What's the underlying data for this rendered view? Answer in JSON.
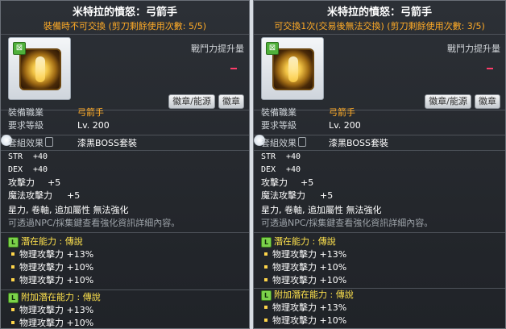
{
  "left": {
    "title": "米特拉的憤怒：弓箭手",
    "subtitle": "裝備時不可交換 (剪刀剩餘使用次數: 5/5)",
    "power_label": "戰鬥力提升量",
    "buttons": [
      "徽章/能源",
      "徽章"
    ],
    "job_label": "裝備職業",
    "job_value": "弓箭手",
    "req_label": "要求等級",
    "req_value": "Lv. 200",
    "set_label": "套組效果",
    "set_value": "漆黑BOSS套裝",
    "stats": [
      {
        "label": "STR",
        "value": "+40"
      },
      {
        "label": "DEX",
        "value": "+40"
      },
      {
        "label": "攻擊力",
        "value": "+5"
      },
      {
        "label": "魔法攻擊力",
        "value": "+5"
      }
    ],
    "notes": "星力, 卷軸, 追加屬性 無法強化",
    "npc_note": "可透過NPC/採集鍵查看強化資訊詳細內容。",
    "potential_title": "潛在能力 : 傳說",
    "potential_lines": [
      "物理攻擊力 +13%",
      "物理攻擊力 +10%",
      "物理攻擊力 +10%"
    ],
    "add_potential_title": "附加潛在能力 : 傳說",
    "add_potential_lines": [
      "物理攻擊力 +13%",
      "物理攻擊力 +10%"
    ],
    "badge_letter": "L"
  },
  "right": {
    "title": "米特拉的憤怒：弓箭手",
    "subtitle": "可交換1次(交易後無法交換) (剪刀剩餘使用次數: 3/5)",
    "power_label": "戰鬥力提升量",
    "buttons": [
      "徽章/能源",
      "徽章"
    ],
    "job_label": "裝備職業",
    "job_value": "弓箭手",
    "req_label": "要求等級",
    "req_value": "Lv. 200",
    "set_label": "套組效果",
    "set_value": "漆黑BOSS套裝",
    "stats": [
      {
        "label": "STR",
        "value": "+40"
      },
      {
        "label": "DEX",
        "value": "+40"
      },
      {
        "label": "攻擊力",
        "value": "+5"
      },
      {
        "label": "魔法攻擊力",
        "value": "+5"
      }
    ],
    "notes": "星力, 卷軸, 追加屬性 無法強化",
    "npc_note": "可透過NPC/採集鍵查看強化資訊詳細內容。",
    "potential_title": "潛在能力 : 傳說",
    "potential_lines": [
      "物理攻擊力 +13%",
      "物理攻擊力 +10%",
      "物理攻擊力 +10%"
    ],
    "add_potential_title": "附加潛在能力 : 傳說",
    "add_potential_lines": [
      "物理攻擊力 +13%",
      "物理攻擊力 +10%"
    ],
    "badge_letter": "L"
  },
  "colors": {
    "subtitle": "#ffab27",
    "job_value": "#ffab27",
    "grade_title": "#ffe34d",
    "power_dash": "#ff3c6a",
    "badge": "#7bd24a"
  },
  "icons": {
    "item": "golden-emblem-icon",
    "tradeable": "green-tradeable-badge-icon",
    "set": "set-effect-icon",
    "grade": "legendary-grade-icon"
  }
}
